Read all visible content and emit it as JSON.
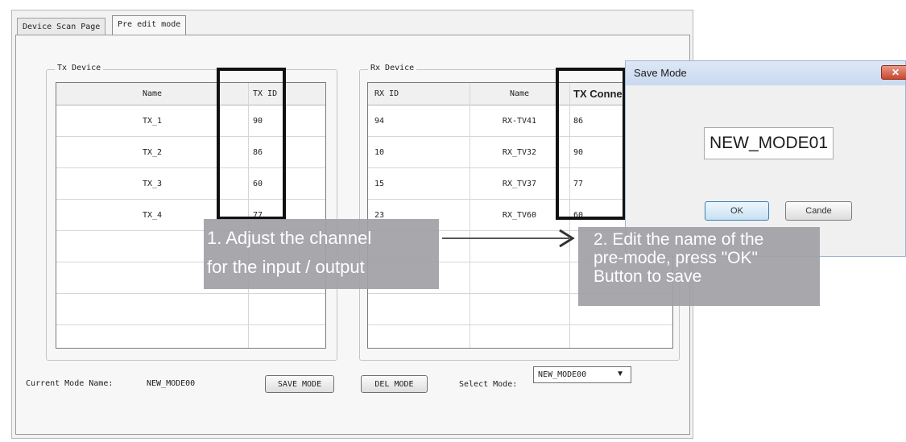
{
  "tabs": [
    {
      "label": "Device Scan Page",
      "active": false
    },
    {
      "label": "Pre edit mode",
      "active": true
    }
  ],
  "tx_device": {
    "title": "Tx Device",
    "columns": [
      "Name",
      "TX ID"
    ],
    "rows": [
      {
        "name": "TX_1",
        "tx_id": "90"
      },
      {
        "name": "TX_2",
        "tx_id": "86"
      },
      {
        "name": "TX_3",
        "tx_id": "60"
      },
      {
        "name": "TX_4",
        "tx_id": "77"
      }
    ]
  },
  "rx_device": {
    "title": "Rx Device",
    "columns": [
      "RX ID",
      "Name",
      "TX Connec"
    ],
    "rows": [
      {
        "rx_id": "94",
        "name": "RX-TV41",
        "tx_connect": "86"
      },
      {
        "rx_id": "10",
        "name": "RX_TV32",
        "tx_connect": "90"
      },
      {
        "rx_id": "15",
        "name": "RX_TV37",
        "tx_connect": "77"
      },
      {
        "rx_id": "23",
        "name": "RX_TV60",
        "tx_connect": "60"
      }
    ]
  },
  "bottom_bar": {
    "current_mode_label": "Current Mode Name:",
    "current_mode_value": "NEW_MODE00",
    "save_mode_label": "SAVE MODE",
    "del_mode_label": "DEL MODE",
    "select_mode_label": "Select Mode:",
    "select_mode_value": "NEW_MODE00"
  },
  "callouts": {
    "step1_line1": "1. Adjust the channel",
    "step1_line2": "for the input / output",
    "step2_line1": "2. Edit the name of the",
    "step2_line2": "pre-mode, press \"OK\"",
    "step2_line3": "Button to save"
  },
  "dialog": {
    "title": "Save Mode",
    "mode_name_value": "NEW_MODE01",
    "ok_label": "OK",
    "cancel_label": "Cande"
  },
  "icons": {
    "close": "close-icon",
    "dropdown": "chevron-down-icon",
    "arrow": "arrow-right-icon"
  },
  "colors": {
    "callout_bg": "#a0a0a5",
    "highlight_border": "#111111",
    "close_button": "#c9472d"
  }
}
